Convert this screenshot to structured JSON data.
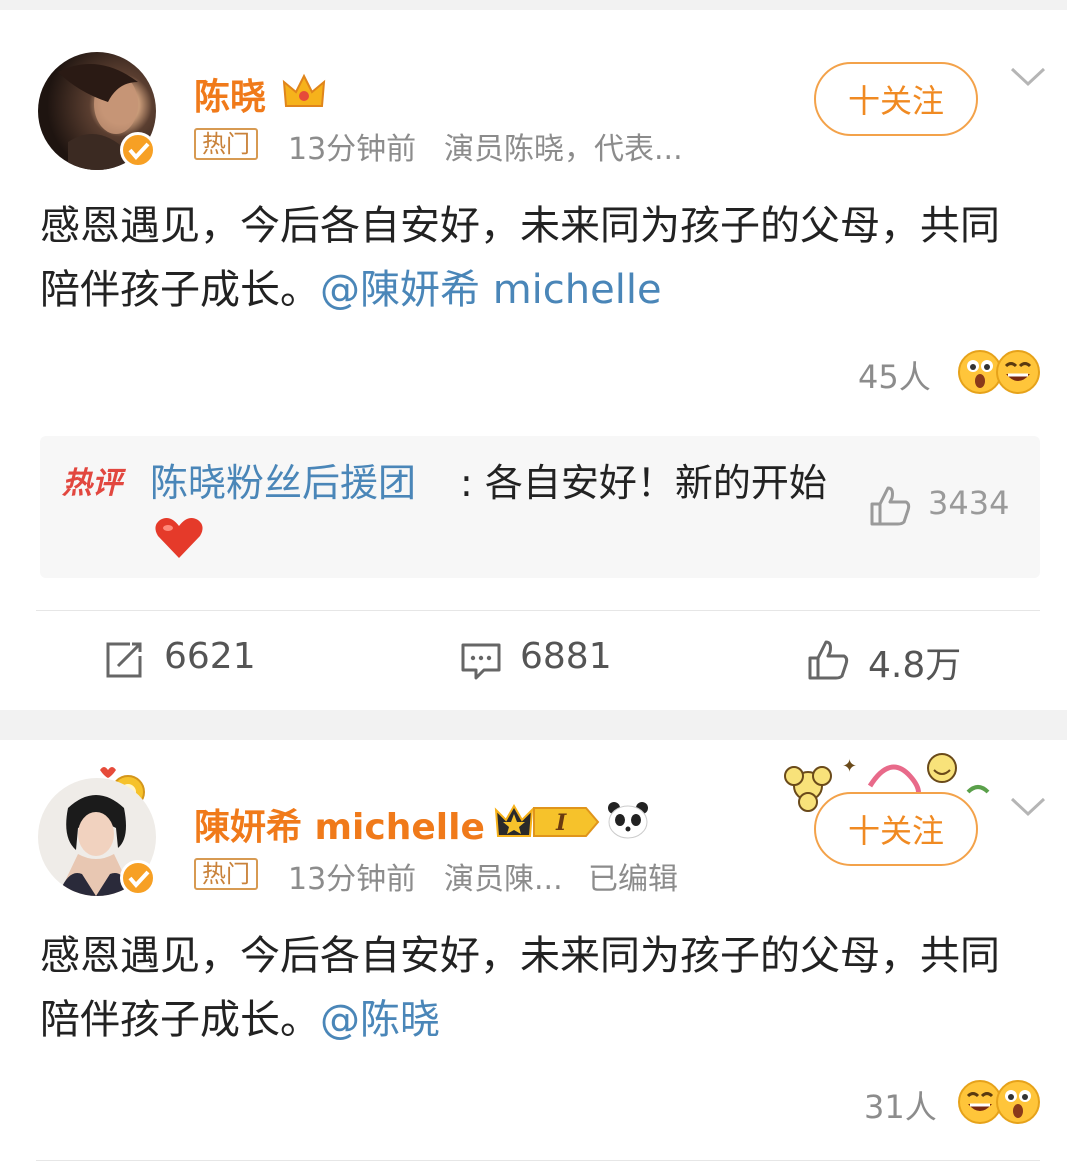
{
  "post1": {
    "username": "陈晓",
    "hot_tag": "热门",
    "time": "13分钟前",
    "source": "演员陈晓，代表...",
    "follow_label": "十关注",
    "text_main": "感恩遇见，今后各自安好，未来同为孩子的父母，共同陪伴孩子成长。",
    "text_mention": "@陳妍希 michelle",
    "reaction_count": "45人",
    "hot_comment": {
      "tag": "热评",
      "author": "陈晓粉丝后援团",
      "text": ": 各自安好！新的开始",
      "likes": "3434"
    },
    "actions": {
      "reposts": "6621",
      "comments": "6881",
      "likes": "4.8万"
    }
  },
  "post2": {
    "username": "陳妍希 michelle",
    "hot_tag": "热门",
    "time": "13分钟前",
    "source": "演员陳...",
    "edited": "已编辑",
    "follow_label": "十关注",
    "text_main": "感恩遇见，今后各自安好，未来同为孩子的父母，共同陪伴孩子成长。",
    "text_mention": "@陈晓",
    "reaction_count": "31人"
  },
  "colors": {
    "username": "#f07a1a",
    "mention": "#4a86b8",
    "hot_comment_tag": "#e2473f",
    "follow_border": "#f3a24a"
  },
  "icons": [
    "crown-icon",
    "verified-badge-icon",
    "chevron-down-icon",
    "surprised-emoji-icon",
    "laughing-emoji-icon",
    "heart-emoji-icon",
    "thumbs-up-icon",
    "repost-icon",
    "comment-icon",
    "panda-icon",
    "vip-level-badge-icon"
  ]
}
